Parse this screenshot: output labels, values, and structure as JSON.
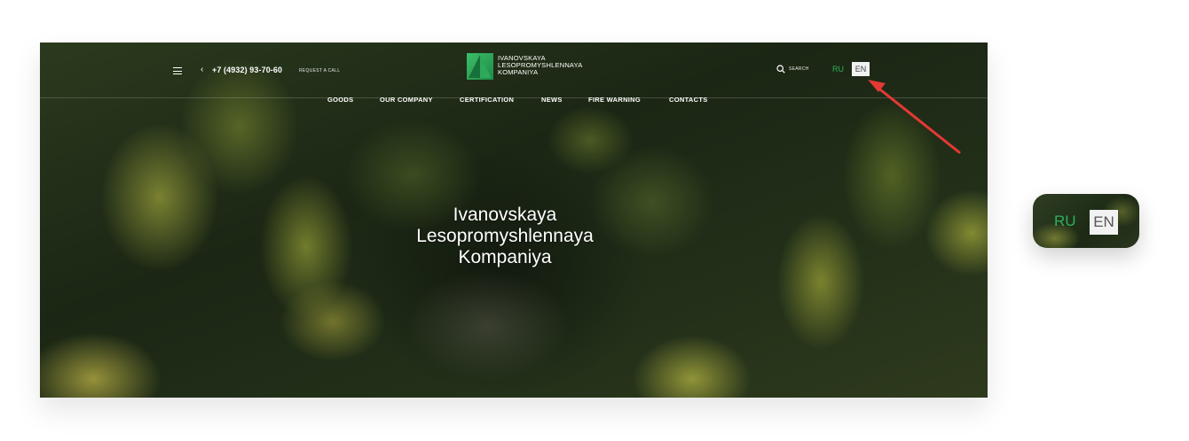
{
  "header": {
    "phone": "+7 (4932) 93-70-60",
    "request_call": "REQUEST A CALL",
    "logo_lines": [
      "IVANOVSKAYA",
      "LESOPROMYSHLENNAYA",
      "KOMPANIYA"
    ],
    "search_label": "SEARCH",
    "lang_ru": "RU",
    "lang_en": "EN"
  },
  "nav": {
    "items": [
      "GOODS",
      "OUR COMPANY",
      "CERTIFICATION",
      "NEWS",
      "FIRE WARNING",
      "CONTACTS"
    ]
  },
  "hero": {
    "lines": [
      "Ivanovskaya",
      "Lesopromyshlennaya",
      "Kompaniya"
    ]
  },
  "zoom": {
    "lang_ru": "RU",
    "lang_en": "EN"
  },
  "colors": {
    "accent_green": "#2fb05a",
    "annotation_arrow": "#e53935"
  },
  "icons": [
    "menu-icon",
    "phone-icon",
    "logo-icon",
    "search-icon",
    "annotation-arrow"
  ]
}
